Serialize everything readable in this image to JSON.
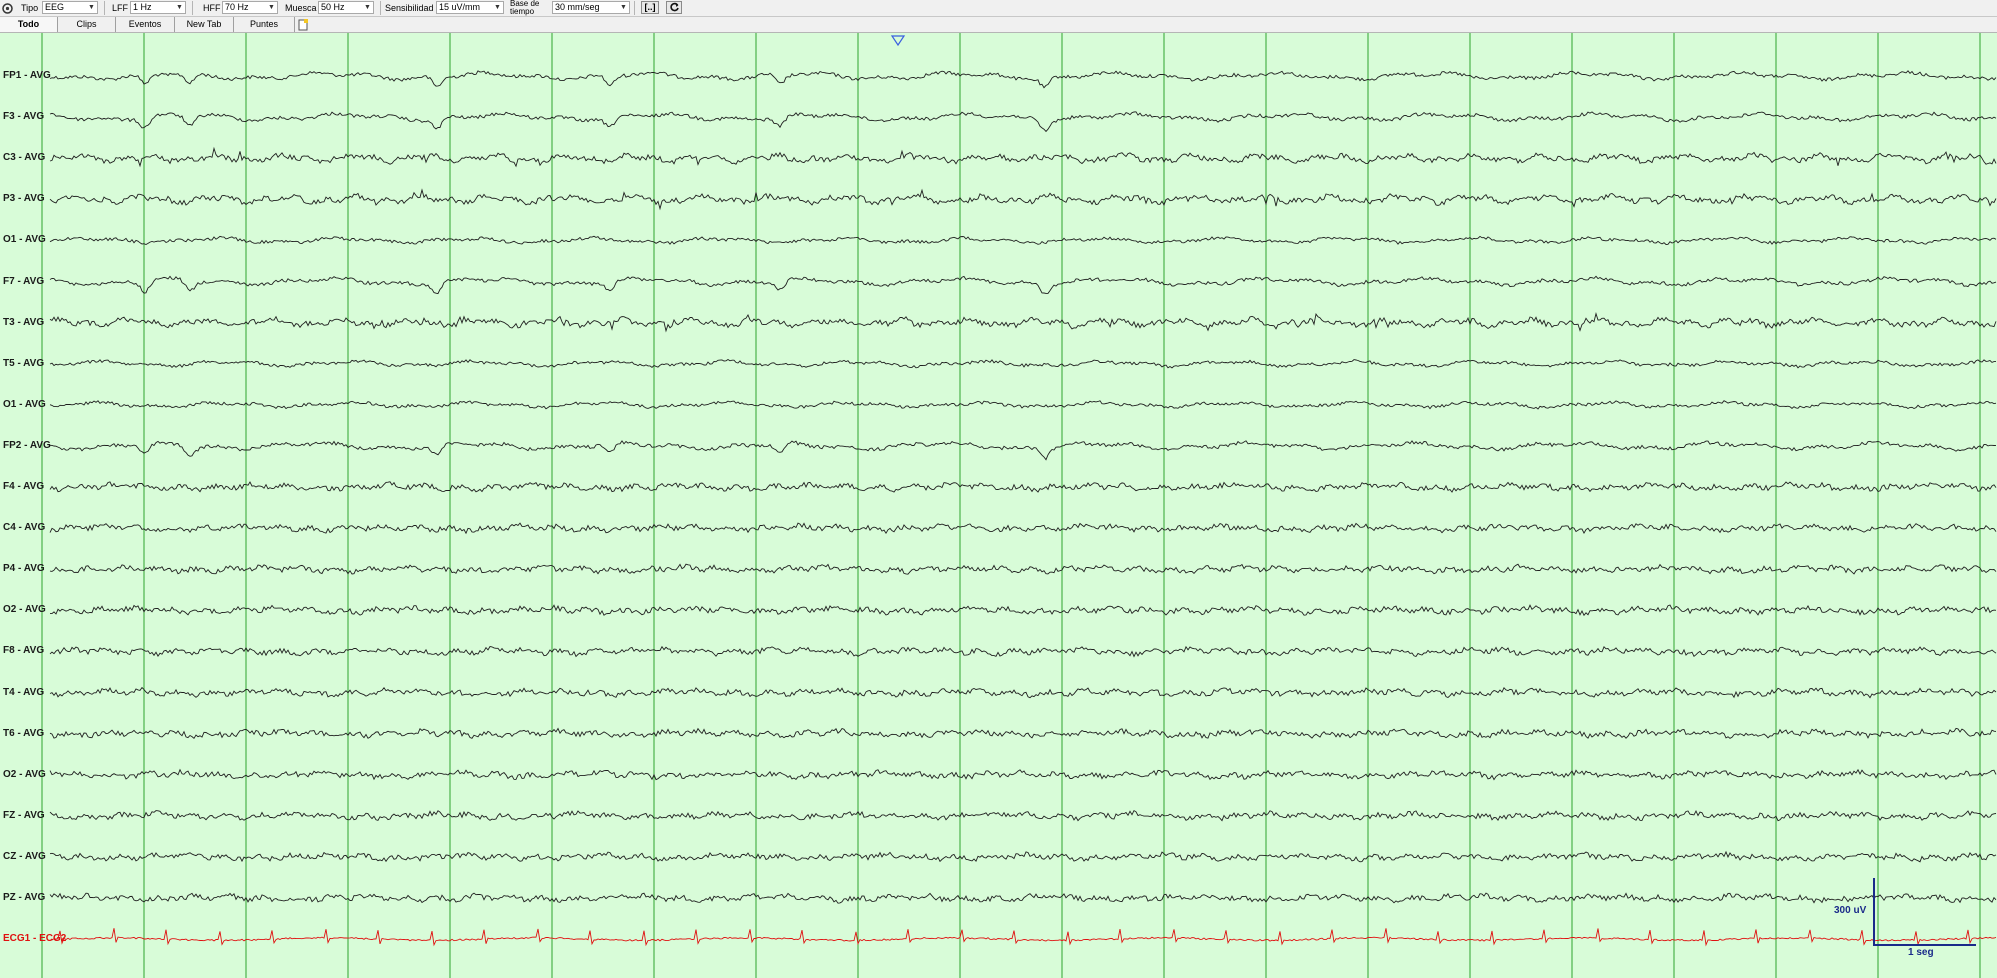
{
  "toolbar": {
    "tipo_label": "Tipo",
    "tipo_value": "EEG",
    "lff_label": "LFF",
    "lff_value": "1 Hz",
    "hff_label": "HFF",
    "hff_value": "70 Hz",
    "muesca_label": "Muesca",
    "muesca_value": "50 Hz",
    "sensibilidad_label": "Sensibilidad",
    "sensibilidad_value": "15 uV/mm",
    "base_label_line1": "Base de",
    "base_label_line2": "tiempo",
    "base_value": "30 mm/seg",
    "btn_bracket": "[..]",
    "refresh_icon": "refresh-icon",
    "settings_icon": "settings-icon"
  },
  "tabs": [
    {
      "label": "Todo",
      "active": true
    },
    {
      "label": "Clips",
      "active": false
    },
    {
      "label": "Eventos",
      "active": false
    },
    {
      "label": "New Tab",
      "active": false
    },
    {
      "label": "Puntes",
      "active": false
    }
  ],
  "new_tab_icon": "new-tab-icon",
  "marker_icon": "event-marker-icon",
  "channels": [
    {
      "label": "FP1 - AVG",
      "type": "frontal"
    },
    {
      "label": "F3 - AVG",
      "type": "frontal"
    },
    {
      "label": "C3 - AVG",
      "type": "central"
    },
    {
      "label": "P3 - AVG",
      "type": "central"
    },
    {
      "label": "O1 - AVG",
      "type": "quiet"
    },
    {
      "label": "F7 - AVG",
      "type": "frontal"
    },
    {
      "label": "T3 - AVG",
      "type": "central"
    },
    {
      "label": "T5 - AVG",
      "type": "quiet"
    },
    {
      "label": "O1 - AVG",
      "type": "quiet"
    },
    {
      "label": "FP2 - AVG",
      "type": "frontal"
    },
    {
      "label": "F4 - AVG",
      "type": "fast"
    },
    {
      "label": "C4 - AVG",
      "type": "fast"
    },
    {
      "label": "P4 - AVG",
      "type": "fast"
    },
    {
      "label": "O2 - AVG",
      "type": "fast"
    },
    {
      "label": "F8 - AVG",
      "type": "fast"
    },
    {
      "label": "T4 - AVG",
      "type": "fast"
    },
    {
      "label": "T6 - AVG",
      "type": "fast"
    },
    {
      "label": "O2 - AVG",
      "type": "fast"
    },
    {
      "label": "FZ - AVG",
      "type": "fast"
    },
    {
      "label": "CZ - AVG",
      "type": "fast"
    },
    {
      "label": "PZ - AVG",
      "type": "fast"
    },
    {
      "label": "ECG1 - ECG2",
      "type": "ecg"
    }
  ],
  "scale": {
    "amplitude_label": "300 uV",
    "time_label": "1 seg"
  },
  "colors": {
    "background": "#d8fcd8",
    "grid": "#2ea52e",
    "trace": "#1f1f1f",
    "ecg": "#e01010",
    "scale": "#1a2a8a",
    "marker": "#3a5ee0"
  }
}
